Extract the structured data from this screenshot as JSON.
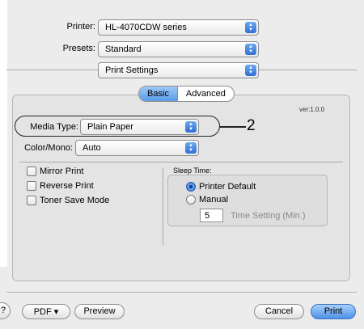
{
  "printer": {
    "label": "Printer:",
    "value": "HL-4070CDW series"
  },
  "presets": {
    "label": "Presets:",
    "value": "Standard"
  },
  "section_menu": {
    "value": "Print Settings"
  },
  "tabs": [
    {
      "label": "Basic",
      "selected": true
    },
    {
      "label": "Advanced",
      "selected": false
    }
  ],
  "version": "ver:1.0.0",
  "media_type": {
    "label": "Media Type:",
    "value": "Plain Paper"
  },
  "callout": "2",
  "color_mono": {
    "label": "Color/Mono:",
    "value": "Auto"
  },
  "options": {
    "mirror_print": "Mirror Print",
    "reverse_print": "Reverse Print",
    "toner_save": "Toner Save Mode"
  },
  "sleep": {
    "title": "Sleep Time:",
    "printer_default": "Printer Default",
    "manual": "Manual",
    "time_value": "5",
    "time_label": "Time Setting (Min.)"
  },
  "footer": {
    "help": "?",
    "pdf": "PDF ▾",
    "preview": "Preview",
    "cancel": "Cancel",
    "print": "Print"
  },
  "colors": {
    "accent": "#4d90e6",
    "background": "#ececec"
  }
}
